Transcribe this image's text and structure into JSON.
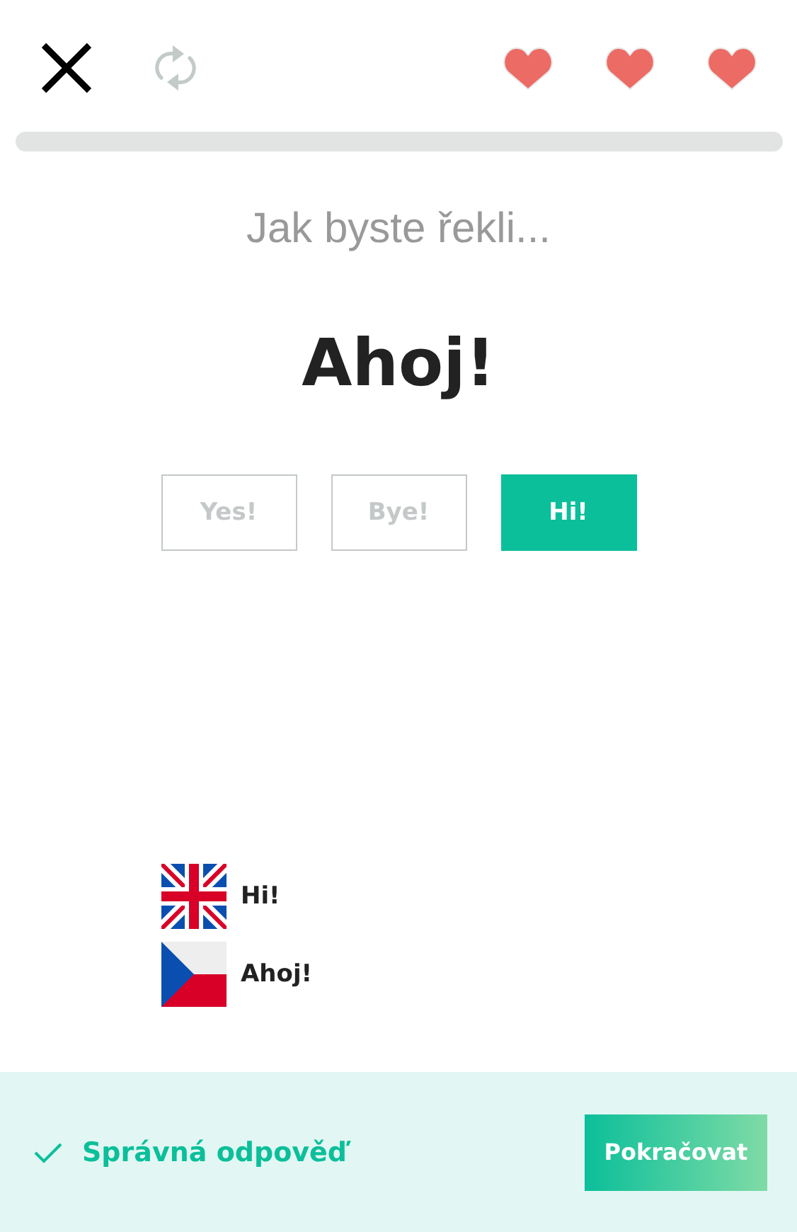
{
  "lives": [
    {
      "filled": true
    },
    {
      "filled": true
    },
    {
      "filled": true
    }
  ],
  "prompt": "Jak byste řekli...",
  "phrase": "Ahoj!",
  "options": [
    {
      "label": "Yes!",
      "selected": false
    },
    {
      "label": "Bye!",
      "selected": false
    },
    {
      "label": "Hi!",
      "selected": true
    }
  ],
  "translations": [
    {
      "kind": "gb",
      "text": "Hi!"
    },
    {
      "kind": "cz",
      "text": "Ahoj!"
    }
  ],
  "footer": {
    "message": "Správná odpověď",
    "button": "Pokračovat"
  }
}
